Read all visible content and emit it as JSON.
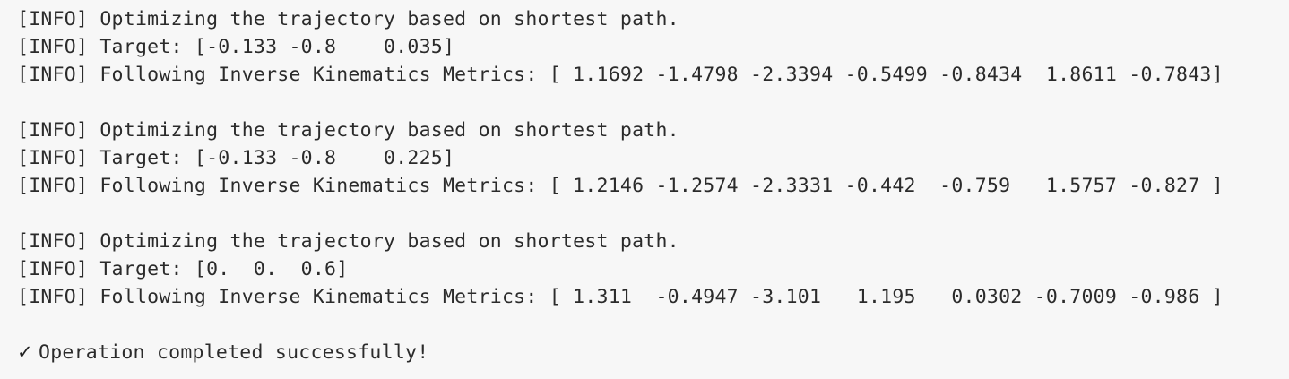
{
  "log": {
    "blocks": [
      {
        "optimize": "[INFO] Optimizing the trajectory based on shortest path.",
        "target": "[INFO] Target: [-0.133 -0.8    0.035]",
        "ik": "[INFO] Following Inverse Kinematics Metrics: [ 1.1692 -1.4798 -2.3394 -0.5499 -0.8434  1.8611 -0.7843]"
      },
      {
        "optimize": "[INFO] Optimizing the trajectory based on shortest path.",
        "target": "[INFO] Target: [-0.133 -0.8    0.225]",
        "ik": "[INFO] Following Inverse Kinematics Metrics: [ 1.2146 -1.2574 -2.3331 -0.442  -0.759   1.5757 -0.827 ]"
      },
      {
        "optimize": "[INFO] Optimizing the trajectory based on shortest path.",
        "target": "[INFO] Target: [0.  0.  0.6]",
        "ik": "[INFO] Following Inverse Kinematics Metrics: [ 1.311  -0.4947 -3.101   1.195   0.0302 -0.7009 -0.986 ]"
      }
    ],
    "success": {
      "icon": "checkmark-icon",
      "glyph": "✓",
      "message": "Operation completed successfully!"
    }
  }
}
